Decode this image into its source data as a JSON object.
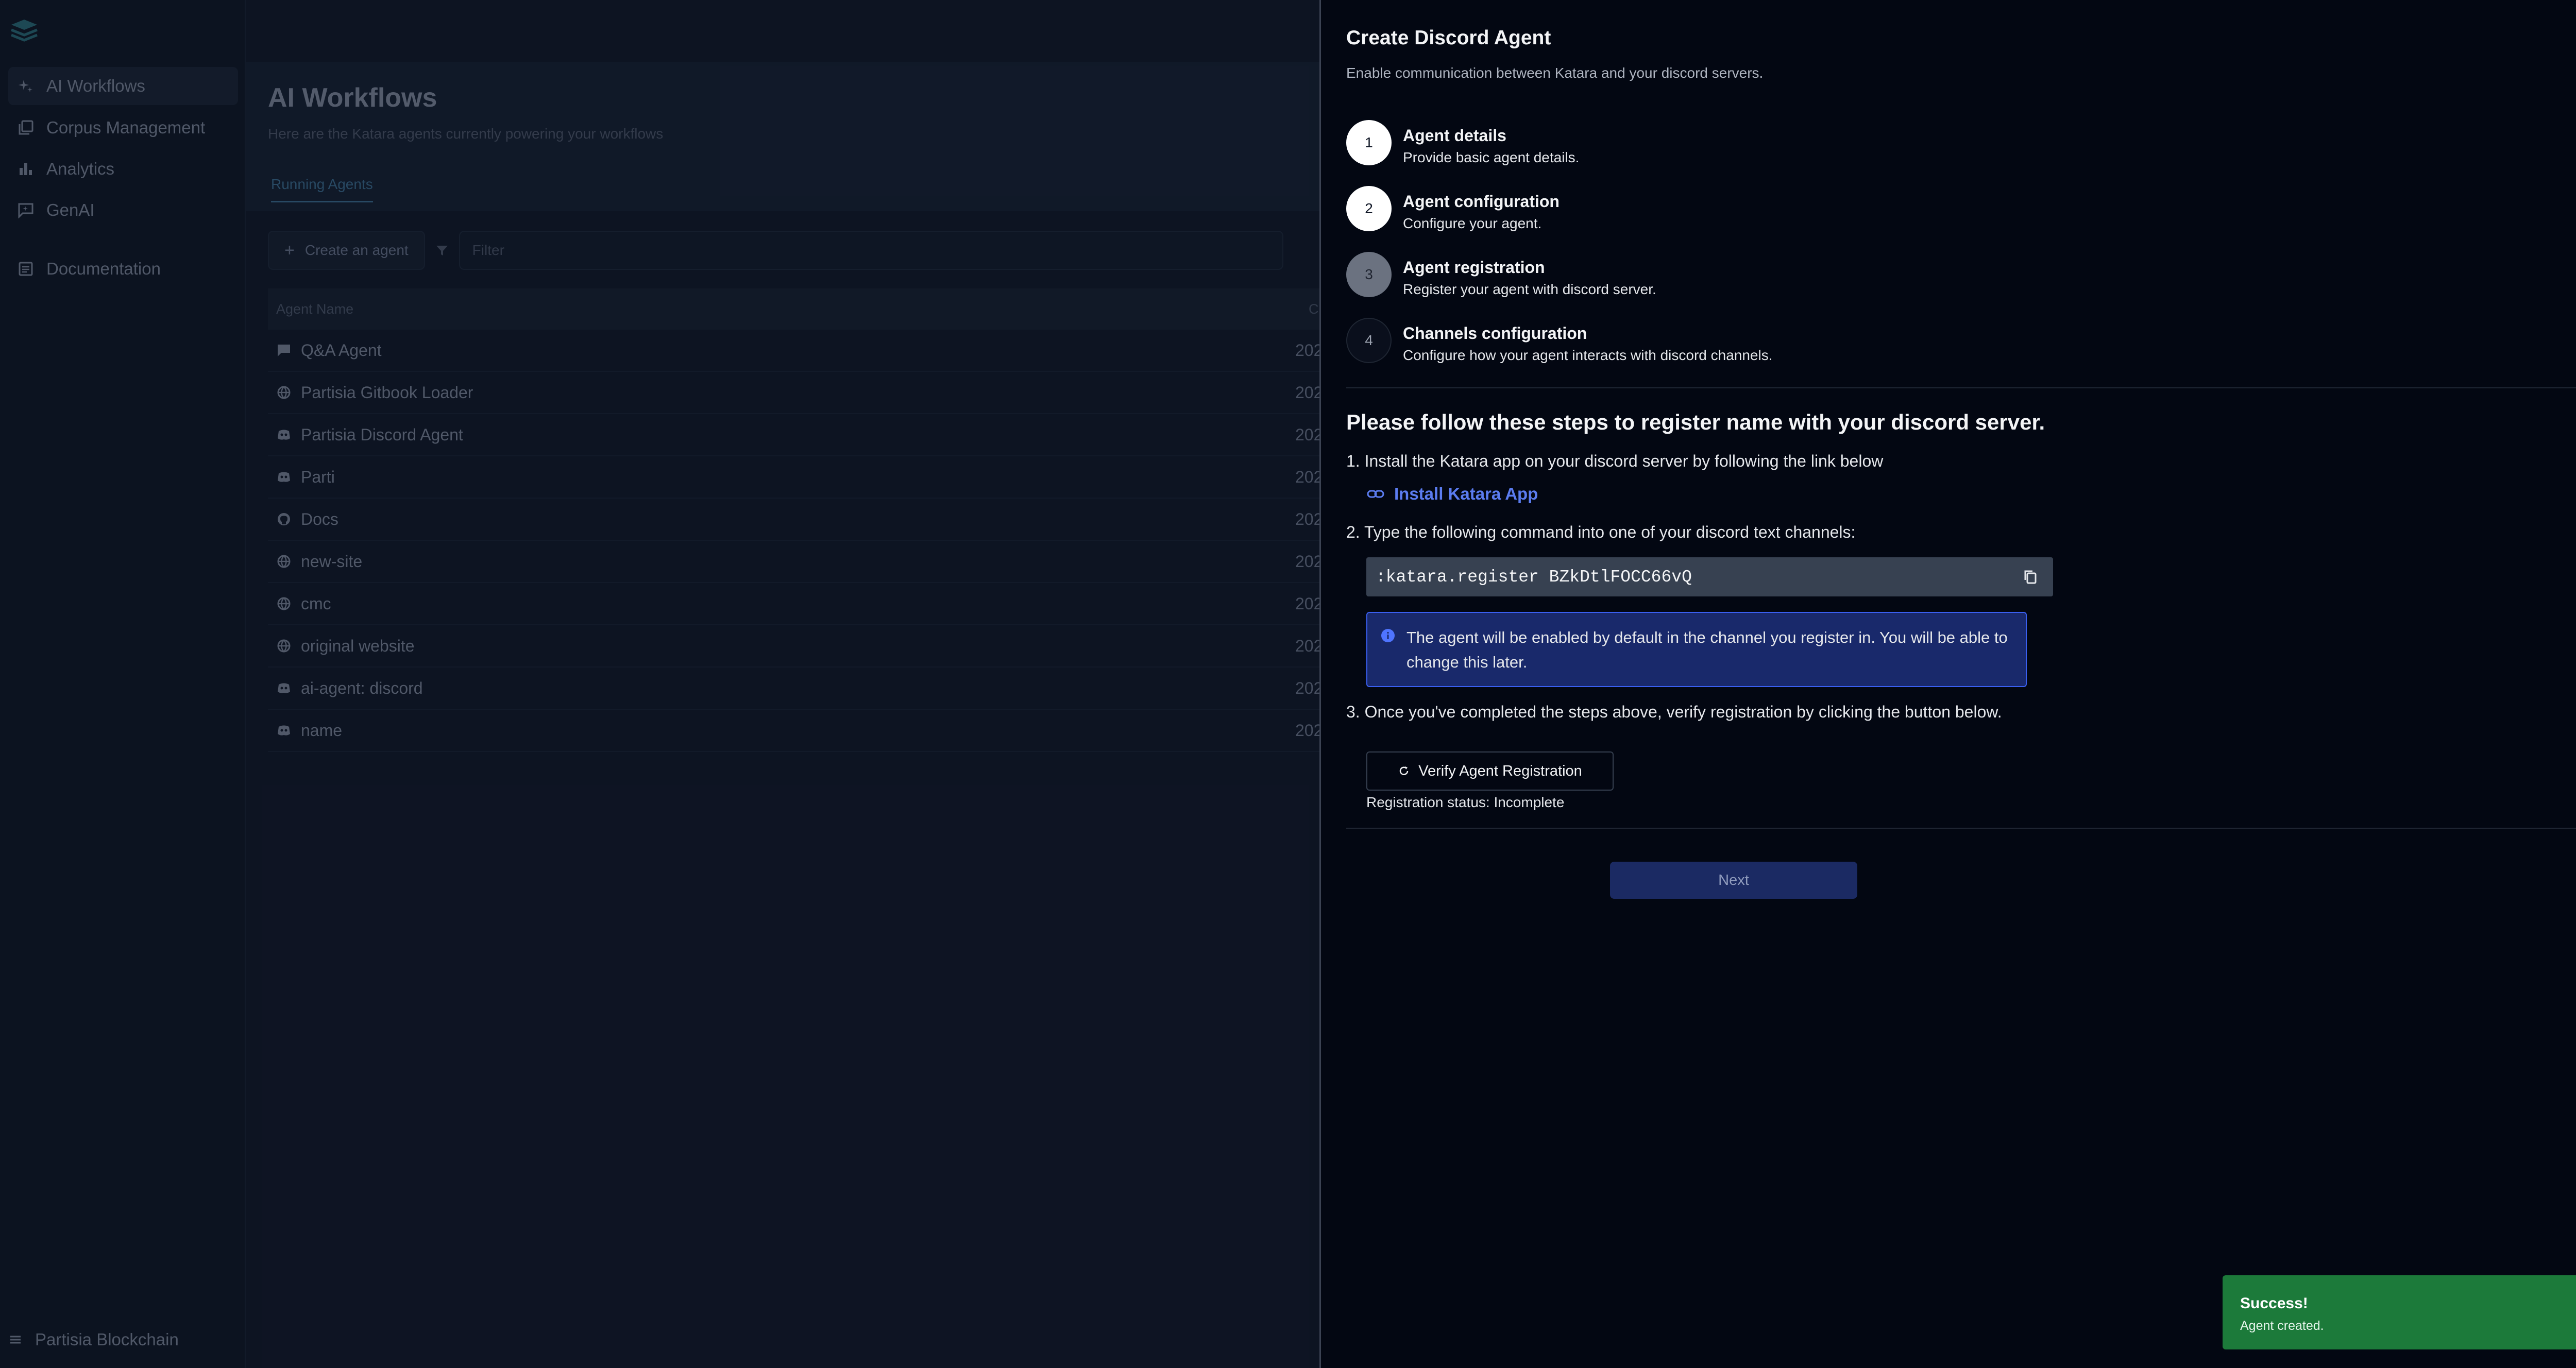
{
  "sidebar": {
    "logo_icon": "katara-logo-icon",
    "items": [
      {
        "label": "AI Workflows",
        "icon": "sparkle-icon",
        "active": true
      },
      {
        "label": "Corpus Management",
        "icon": "library-icon",
        "active": false
      },
      {
        "label": "Analytics",
        "icon": "bar-chart-icon",
        "active": false
      },
      {
        "label": "GenAI",
        "icon": "chat-icon",
        "active": false
      },
      {
        "label": "Documentation",
        "icon": "document-icon",
        "active": false
      }
    ],
    "workspace": {
      "label": "Partisia Blockchain",
      "icon": "menu-icon"
    }
  },
  "main": {
    "title": "AI Workflows",
    "subtitle": "Here are the Katara agents currently powering your workflows",
    "tab_label": "Running Agents",
    "create_agent_label": "Create an agent",
    "filter_placeholder": "Filter",
    "table": {
      "columns": [
        "Agent Name",
        "Crea"
      ],
      "rows": [
        {
          "name": "Q&A Agent",
          "icon": "chat-icon",
          "created": "202"
        },
        {
          "name": "Partisia Gitbook Loader",
          "icon": "globe-icon",
          "created": "202"
        },
        {
          "name": "Partisia Discord Agent",
          "icon": "discord-icon",
          "created": "202"
        },
        {
          "name": "Parti",
          "icon": "discord-icon",
          "created": "202"
        },
        {
          "name": "Docs",
          "icon": "github-icon",
          "created": "202"
        },
        {
          "name": "new-site",
          "icon": "globe-icon",
          "created": "202"
        },
        {
          "name": "cmc",
          "icon": "globe-icon",
          "created": "202"
        },
        {
          "name": "original website",
          "icon": "globe-icon",
          "created": "202"
        },
        {
          "name": "ai-agent: discord",
          "icon": "discord-icon",
          "created": "202"
        },
        {
          "name": "name",
          "icon": "discord-icon",
          "created": "202"
        }
      ]
    }
  },
  "drawer": {
    "title": "Create Discord Agent",
    "subtitle": "Enable communication between Katara and your discord servers.",
    "close_label": "×",
    "steps": [
      {
        "number": "1",
        "title": "Agent details",
        "description": "Provide basic agent details.",
        "state": "done"
      },
      {
        "number": "2",
        "title": "Agent configuration",
        "description": "Configure your agent.",
        "state": "done"
      },
      {
        "number": "3",
        "title": "Agent registration",
        "description": "Register your agent with discord server.",
        "state": "current"
      },
      {
        "number": "4",
        "title": "Channels configuration",
        "description": "Configure how your agent interacts with discord channels.",
        "state": "todo"
      }
    ],
    "instructions_title": "Please follow these steps to register name with your discord server.",
    "step1_text": "1. Install the Katara app on your discord server by following the link below",
    "install_link_label": "Install Katara App",
    "step2_text": "2. Type the following command into one of your discord text channels:",
    "command": ":katara.register BZkDtlFOCC66vQ",
    "info_text": "The agent will be enabled by default in the channel you register in. You will be able to change this later.",
    "step3_text": "3. Once you've completed the steps above, verify registration by clicking the button below.",
    "verify_label": "Verify Agent Registration",
    "registration_status": "Registration status: Incomplete",
    "next_label": "Next"
  },
  "toast": {
    "title": "Success!",
    "message": "Agent created.",
    "color": "#1c7a3a"
  },
  "colors": {
    "accent_link": "#5b7cf0",
    "info_bg": "#19296b",
    "info_border": "#3a5ff0"
  }
}
